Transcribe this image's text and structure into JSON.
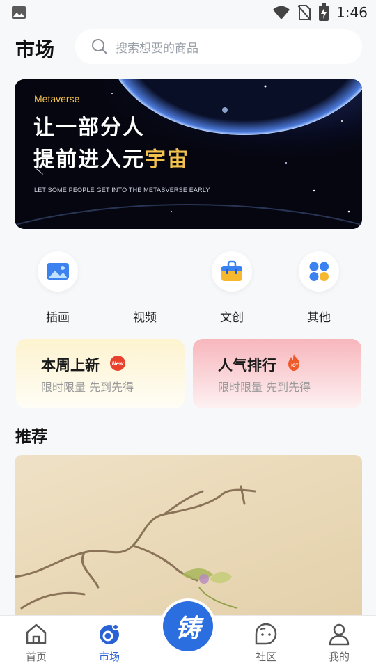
{
  "status_bar": {
    "time": "1:46"
  },
  "header": {
    "title": "市场",
    "search_placeholder": "搜索想要的商品"
  },
  "banner": {
    "sub": "Metaverse",
    "line1": "让一部分人",
    "line2_pre": "提前进入元",
    "line2_hl": "宇宙",
    "tagline": "LET SOME PEOPLE GET INTO THE METASVERSE EARLY"
  },
  "categories": [
    {
      "label": "插画",
      "icon": "picture-icon"
    },
    {
      "label": "视频",
      "icon": ""
    },
    {
      "label": "文创",
      "icon": "shopping-bag-icon"
    },
    {
      "label": "其他",
      "icon": "grid-icon"
    }
  ],
  "promos": [
    {
      "title": "本周上新",
      "subtitle": "限时限量 先到先得",
      "badge": "New",
      "colors": {
        "badge": "#e8412e"
      }
    },
    {
      "title": "人气排行",
      "subtitle": "限时限量 先到先得",
      "badge": "HOT",
      "colors": {
        "badge": "#ef5a2a"
      }
    }
  ],
  "recommend": {
    "title": "推荐"
  },
  "tabs": [
    {
      "label": "首页",
      "icon": "home-icon",
      "active": false
    },
    {
      "label": "市场",
      "icon": "market-icon",
      "active": true
    },
    {
      "label": "社区",
      "icon": "community-icon",
      "active": false
    },
    {
      "label": "我的",
      "icon": "user-icon",
      "active": false
    }
  ],
  "fab": {
    "label": "铸"
  },
  "colors": {
    "accent": "#2a6ee0",
    "active_tab": "#2a62d6",
    "banner_gold": "#f2c14e"
  }
}
